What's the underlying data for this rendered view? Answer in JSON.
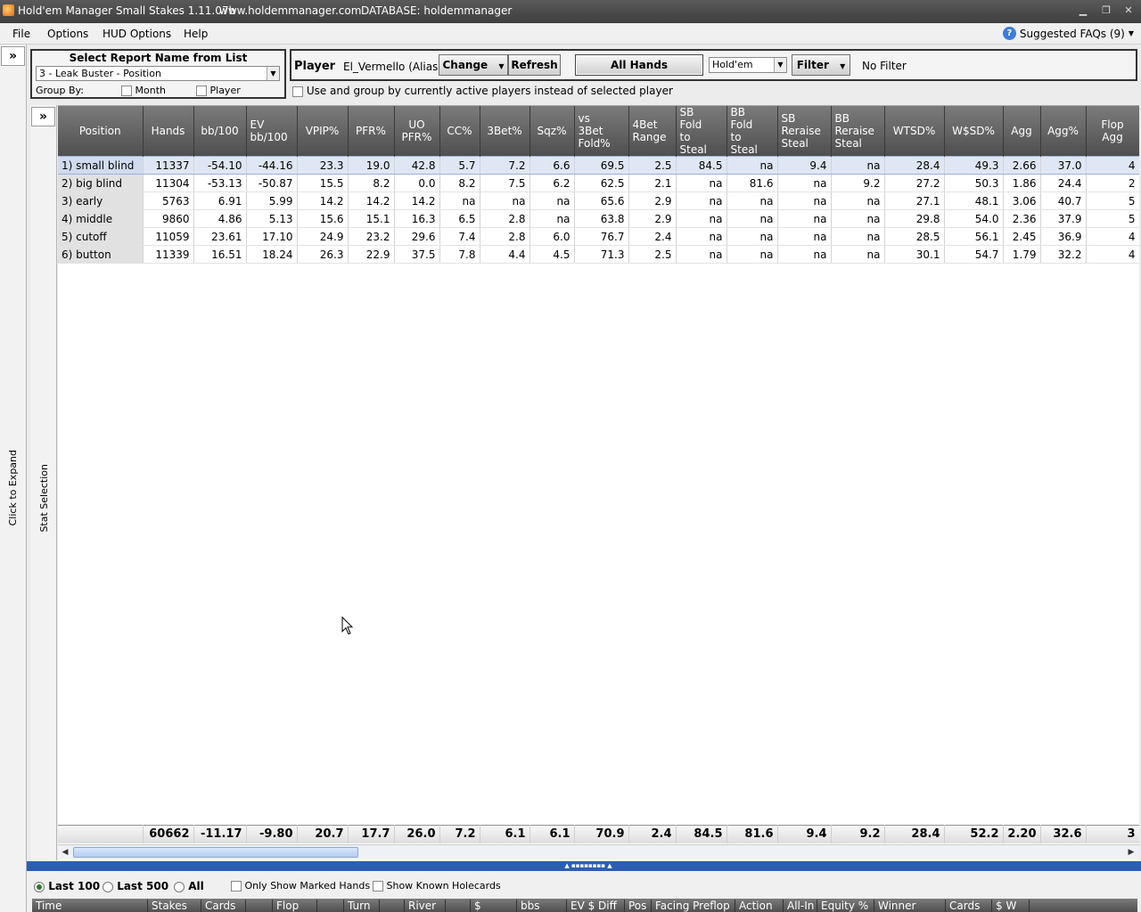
{
  "window": {
    "title": "Hold'em Manager Small Stakes 1.11.07b",
    "website": "www.holdemmanager.com",
    "database": "DATABASE: holdemmanager"
  },
  "menu": {
    "file": "File",
    "options": "Options",
    "hud_options": "HUD Options",
    "help": "Help",
    "faq": "Suggested FAQs (9)"
  },
  "left_strip": {
    "expand_label": "Click to Expand",
    "stat_selection": "Stat Selection",
    "expand_icon": "»"
  },
  "report": {
    "title": "Select Report Name from List",
    "selected": "3 - Leak Buster - Position",
    "group_by": "Group By:",
    "month": "Month",
    "player": "Player"
  },
  "player_panel": {
    "label": "Player",
    "name": "El_Vermello (Alias)",
    "change": "Change",
    "refresh": "Refresh",
    "all_hands": "All Hands",
    "game": "Hold'em",
    "filter": "Filter",
    "filter_status": "No Filter",
    "active_players": "Use and group by currently active players instead of selected player"
  },
  "table": {
    "headers": [
      "Position",
      "Hands",
      "bb/100",
      "EV bb/100",
      "VPIP%",
      "PFR%",
      "UO PFR%",
      "CC%",
      "3Bet%",
      "Sqz%",
      "vs 3Bet Fold%",
      "4Bet Range",
      "SB Fold to Steal",
      "BB Fold to Steal",
      "SB Reraise Steal",
      "BB Reraise Steal",
      "WTSD%",
      "W$SD%",
      "Agg",
      "Agg%",
      "Flop Agg"
    ],
    "rows": [
      [
        "1) small blind",
        "11337",
        "-54.10",
        "-44.16",
        "23.3",
        "19.0",
        "42.8",
        "5.7",
        "7.2",
        "6.6",
        "69.5",
        "2.5",
        "84.5",
        "na",
        "9.4",
        "na",
        "28.4",
        "49.3",
        "2.66",
        "37.0",
        "4"
      ],
      [
        "2) big blind",
        "11304",
        "-53.13",
        "-50.87",
        "15.5",
        "8.2",
        "0.0",
        "8.2",
        "7.5",
        "6.2",
        "62.5",
        "2.1",
        "na",
        "81.6",
        "na",
        "9.2",
        "27.2",
        "50.3",
        "1.86",
        "24.4",
        "2"
      ],
      [
        "3) early",
        "5763",
        "6.91",
        "5.99",
        "14.2",
        "14.2",
        "14.2",
        "na",
        "na",
        "na",
        "65.6",
        "2.9",
        "na",
        "na",
        "na",
        "na",
        "27.1",
        "48.1",
        "3.06",
        "40.7",
        "5"
      ],
      [
        "4) middle",
        "9860",
        "4.86",
        "5.13",
        "15.6",
        "15.1",
        "16.3",
        "6.5",
        "2.8",
        "na",
        "63.8",
        "2.9",
        "na",
        "na",
        "na",
        "na",
        "29.8",
        "54.0",
        "2.36",
        "37.9",
        "5"
      ],
      [
        "5) cutoff",
        "11059",
        "23.61",
        "17.10",
        "24.9",
        "23.2",
        "29.6",
        "7.4",
        "2.8",
        "6.0",
        "76.7",
        "2.4",
        "na",
        "na",
        "na",
        "na",
        "28.5",
        "56.1",
        "2.45",
        "36.9",
        "4"
      ],
      [
        "6) button",
        "11339",
        "16.51",
        "18.24",
        "26.3",
        "22.9",
        "37.5",
        "7.8",
        "4.4",
        "4.5",
        "71.3",
        "2.5",
        "na",
        "na",
        "na",
        "na",
        "30.1",
        "54.7",
        "1.79",
        "32.2",
        "4"
      ]
    ],
    "totals": [
      "",
      "60662",
      "-11.17",
      "-9.80",
      "20.7",
      "17.7",
      "26.0",
      "7.2",
      "6.1",
      "6.1",
      "70.9",
      "2.4",
      "84.5",
      "81.6",
      "9.4",
      "9.2",
      "28.4",
      "52.2",
      "2.20",
      "32.6",
      "3"
    ]
  },
  "bottom": {
    "last100": "Last 100",
    "last500": "Last 500",
    "all": "All",
    "marked": "Only Show Marked Hands",
    "holecards": "Show Known Holecards",
    "columns": [
      "Time",
      "Stakes",
      "Cards",
      "",
      "Flop",
      "",
      "Turn",
      "",
      "River",
      "",
      "$",
      "bbs",
      "EV $ Diff",
      "Pos",
      "Facing Preflop",
      "Action",
      "All-In",
      "Equity %",
      "Winner",
      "Cards",
      "$ W"
    ]
  }
}
